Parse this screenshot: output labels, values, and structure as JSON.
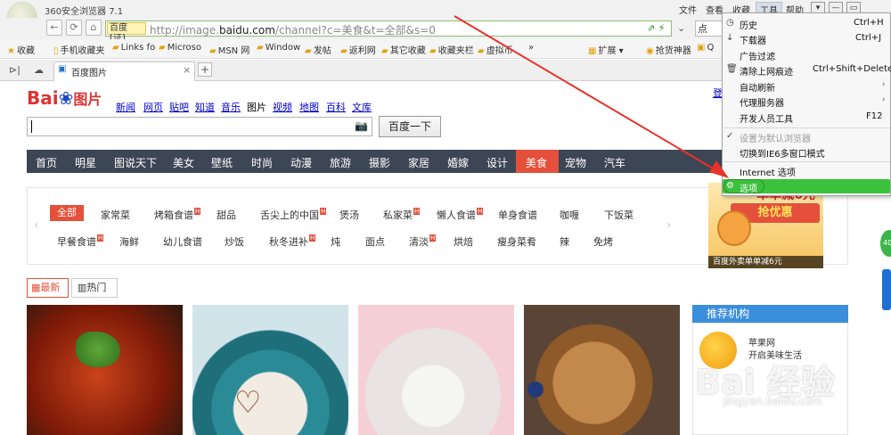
{
  "app": {
    "title": "360安全浏览器 7.1"
  },
  "menubar": [
    "文件",
    "查看",
    "收藏",
    "工具",
    "帮助"
  ],
  "window_buttons": [
    "▾",
    "—",
    "▭"
  ],
  "address": {
    "badge": "百度 [证]",
    "url_prefix": "http://image.",
    "url_host": "baidu.com",
    "url_rest": "/channel?c=美食&t=全部&s=0",
    "search_hint": "点"
  },
  "favorites": [
    "收藏",
    "手机收藏夹",
    "Links fo",
    "Microso",
    "MSN 网",
    "Window",
    "发帖",
    "返利网",
    "其它收藏",
    "收藏夹栏",
    "虚拟币",
    "扩展",
    "抢货神器",
    "Q"
  ],
  "tab": {
    "label": "百度图片",
    "close": "×",
    "new": "+"
  },
  "page": {
    "logo_main": "Bai",
    "logo_du": "du",
    "logo_img": "图片",
    "nav": [
      "新闻",
      "网页",
      "贴吧",
      "知道",
      "音乐",
      "图片",
      "视频",
      "地图",
      "百科",
      "文库"
    ],
    "login": "登录",
    "search_button": "百度一下",
    "categories": [
      "首页",
      "明星",
      "图说天下",
      "美女",
      "壁纸",
      "时尚",
      "动漫",
      "旅游",
      "摄影",
      "家居",
      "婚嫁",
      "设计",
      "美食",
      "宠物",
      "汽车"
    ],
    "active_category": "美食",
    "tags_row1": [
      "全部",
      "家常菜",
      "烤箱食谱",
      "甜品",
      "舌尖上的中国",
      "煲汤",
      "私家菜",
      "懒人食谱",
      "单身食谱",
      "咖喱",
      "下饭菜"
    ],
    "tags_row2": [
      "早餐食谱",
      "海鲜",
      "幼儿食谱",
      "炒饭",
      "秋冬进补",
      "炖",
      "面点",
      "清淡",
      "烘焙",
      "瘦身菜肴",
      "辣",
      "免烤"
    ],
    "hot_badge": "H",
    "ad": {
      "headline": "单单减6元",
      "subline": "抢优惠",
      "caption": "百度外卖单单减6元"
    },
    "sort": {
      "new": "最新",
      "hot": "热门"
    },
    "recommend": {
      "header": "推荐机构",
      "name": "苹果网",
      "desc": "开启美味生活"
    },
    "watermark": "Bai 经验",
    "watermark_url": "jingyan.baidu.com",
    "side_badge": "40"
  },
  "tools_menu": {
    "items": [
      {
        "label": "历史",
        "shortcut": "Ctrl+H",
        "icon": "clock-icon"
      },
      {
        "label": "下载器",
        "shortcut": "Ctrl+J",
        "icon": "download-icon"
      },
      {
        "label": "广告过滤",
        "shortcut": "",
        "icon": ""
      },
      {
        "label": "清除上网痕迹",
        "shortcut": "Ctrl+Shift+Delete",
        "icon": "trash-icon"
      },
      {
        "label": "自动刷新",
        "shortcut": "",
        "icon": "",
        "submenu": true
      },
      {
        "label": "代理服务器",
        "shortcut": "",
        "icon": "",
        "submenu": true
      },
      {
        "label": "开发人员工具",
        "shortcut": "F12",
        "icon": ""
      },
      {
        "label": "设置为默认浏览器",
        "shortcut": "",
        "icon": "check-icon",
        "disabled": true
      },
      {
        "label": "切换到IE6多窗口模式",
        "shortcut": "",
        "icon": ""
      },
      {
        "label": "Internet 选项",
        "shortcut": "",
        "icon": ""
      },
      {
        "label": "选项",
        "shortcut": "",
        "icon": "gear-icon",
        "highlighted": true
      }
    ]
  },
  "colors": {
    "accent_red": "#e4503b",
    "nav_dark": "#3d4655",
    "highlight_green": "#3cc13c",
    "arrow_red": "#e8322a"
  }
}
